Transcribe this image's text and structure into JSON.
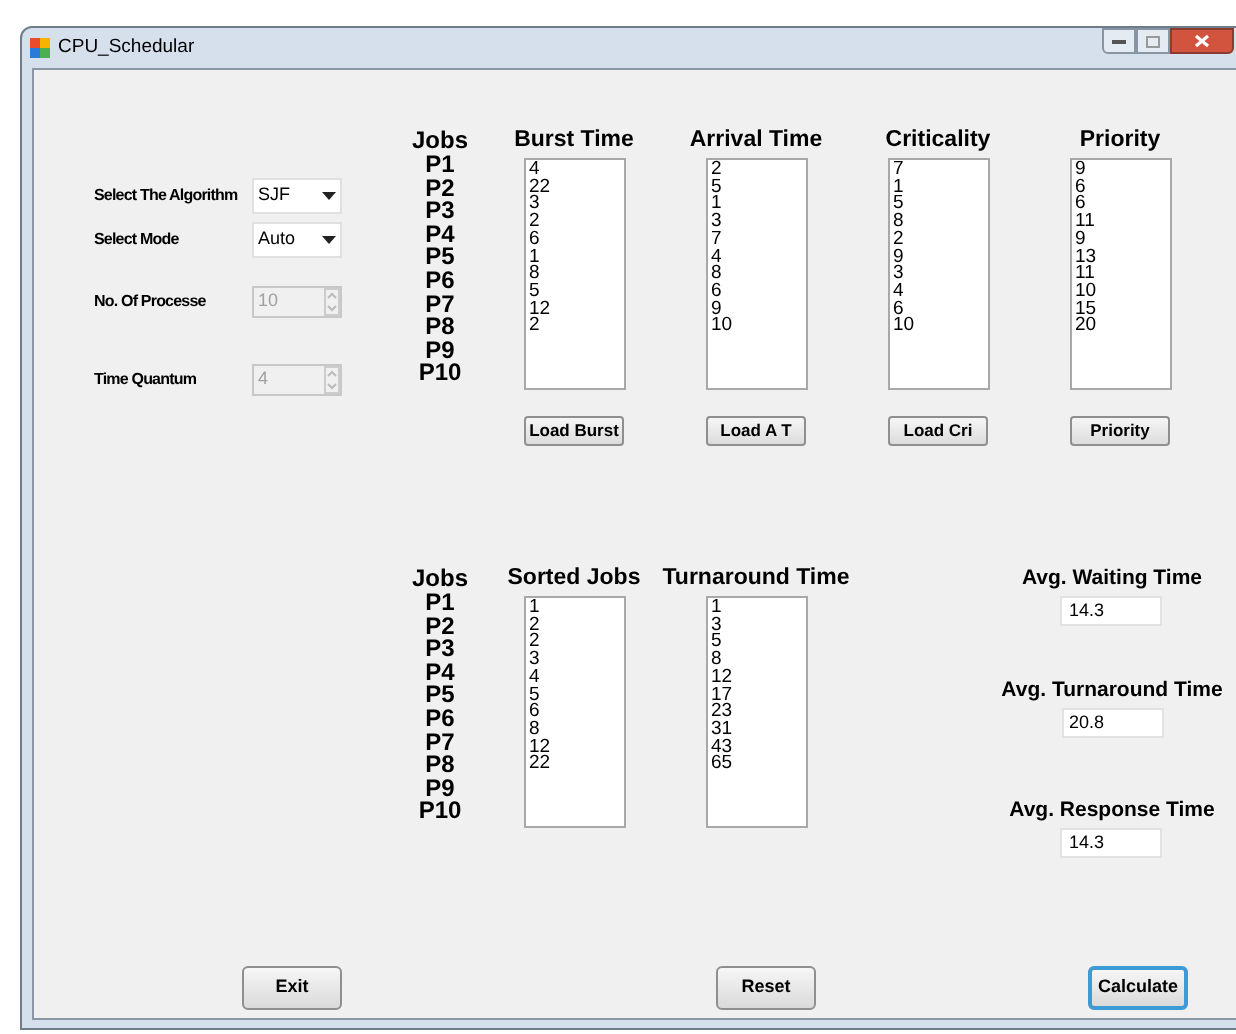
{
  "window": {
    "title": "CPU_Schedular"
  },
  "settings": [
    {
      "kind": "dropdown",
      "label": "Select The Algorithm",
      "value": "SJF",
      "disabled": false
    },
    {
      "kind": "dropdown",
      "label": "Select Mode",
      "value": "Auto",
      "disabled": false
    },
    {
      "kind": "spinner",
      "label": "No. Of Processe",
      "value": "10",
      "disabled": true
    },
    {
      "kind": "spinner",
      "label": "Time Quantum",
      "value": "4",
      "disabled": true
    }
  ],
  "input_jobs": {
    "header": "Jobs",
    "items": [
      "P1",
      "P2",
      "P3",
      "P4",
      "P5",
      "P6",
      "P7",
      "P8",
      "P9",
      "P10"
    ]
  },
  "input_columns": [
    {
      "header": "Burst Time",
      "values": [
        "4",
        "22",
        "3",
        "2",
        "6",
        "1",
        "8",
        "5",
        "12",
        "2"
      ],
      "button": "Load Burst"
    },
    {
      "header": "Arrival Time",
      "values": [
        "2",
        "5",
        "1",
        "3",
        "7",
        "4",
        "8",
        "6",
        "9",
        "10"
      ],
      "button": "Load A T"
    },
    {
      "header": "Criticality",
      "values": [
        "7",
        "1",
        "5",
        "8",
        "2",
        "9",
        "3",
        "4",
        "6",
        "10"
      ],
      "button": "Load Cri"
    },
    {
      "header": "Priority",
      "values": [
        "9",
        "6",
        "6",
        "11",
        "9",
        "13",
        "11",
        "10",
        "15",
        "20"
      ],
      "button": "Priority"
    }
  ],
  "result_jobs": {
    "header": "Jobs",
    "items": [
      "P1",
      "P2",
      "P3",
      "P4",
      "P5",
      "P6",
      "P7",
      "P8",
      "P9",
      "P10"
    ]
  },
  "result_columns": [
    {
      "header": "Sorted Jobs",
      "values": [
        "1",
        "2",
        "2",
        "3",
        "4",
        "5",
        "6",
        "8",
        "12",
        "22"
      ]
    },
    {
      "header": "Turnaround Time",
      "values": [
        "1",
        "3",
        "5",
        "8",
        "12",
        "17",
        "23",
        "31",
        "43",
        "65"
      ]
    }
  ],
  "averages": [
    {
      "label": "Avg. Waiting Time",
      "value": "14.3"
    },
    {
      "label": "Avg. Turnaround Time",
      "value": "20.8"
    },
    {
      "label": "Avg. Response Time",
      "value": "14.3"
    }
  ],
  "buttons": [
    {
      "label": "Exit",
      "focused": false
    },
    {
      "label": "Reset",
      "focused": false
    },
    {
      "label": "Calculate",
      "focused": true
    }
  ]
}
